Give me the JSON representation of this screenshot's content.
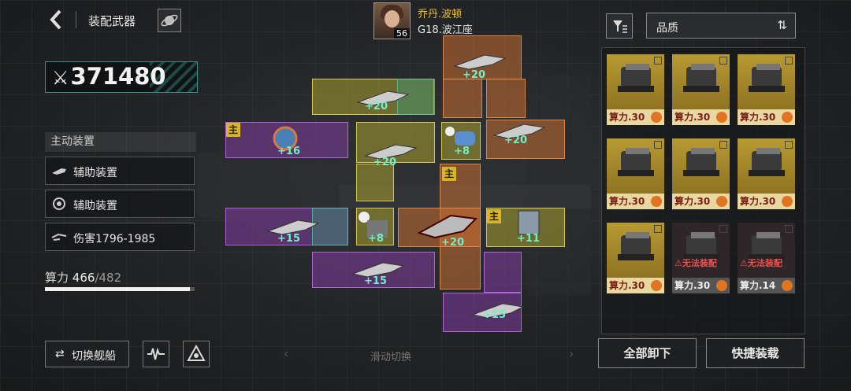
{
  "header": {
    "title": "装配武器",
    "pilot_name": "乔丹.波顿",
    "pilot_level": "56",
    "ship_name": "G18.波江座"
  },
  "left_panel": {
    "power": "371480",
    "active_header": "主动装置",
    "slots": [
      {
        "label": "辅助装置",
        "icon": "cannon-icon"
      },
      {
        "label": "辅助装置",
        "icon": "gear-icon"
      },
      {
        "label": "伤害1796-1985",
        "icon": "damage-icon"
      }
    ],
    "calc_label": "算力",
    "calc_used": "466",
    "calc_max": "/482",
    "calc_fraction": 0.967,
    "switch_label": "切换舰船"
  },
  "grid": {
    "main_tag": "主",
    "bonuses": [
      "+20",
      "+20",
      "+16",
      "+20",
      "+8",
      "+20",
      "+15",
      "+8",
      "+20",
      "+11",
      "+15",
      "+15"
    ],
    "slide_hint": "滑动切换"
  },
  "right_panel": {
    "sort_label": "品质",
    "cards": [
      {
        "label": "算力.30",
        "style": "gold",
        "icon": "gatling-icon"
      },
      {
        "label": "算力.30",
        "style": "gold",
        "icon": "turret-icon"
      },
      {
        "label": "算力.30",
        "style": "gold",
        "icon": "rocket-pod-icon"
      },
      {
        "label": "算力.30",
        "style": "gold",
        "icon": "missile-rack-icon"
      },
      {
        "label": "算力.30",
        "style": "gold",
        "icon": "railgun-icon"
      },
      {
        "label": "算力.30",
        "style": "gold",
        "icon": "plasma-icon"
      },
      {
        "label": "算力.30",
        "style": "gold",
        "icon": "drone-icon"
      },
      {
        "label": "算力.30",
        "style": "dark",
        "warning": "无法装配",
        "icon": "locked-weapon-icon"
      },
      {
        "label": "算力.14",
        "style": "dark",
        "warning": "无法装配",
        "icon": "locked-weapon-icon"
      }
    ],
    "unequip_all": "全部卸下",
    "quick_equip": "快捷装载"
  },
  "colors": {
    "accent_teal": "#3a8f84",
    "orange": "#c86e32",
    "yellow": "#aaa032",
    "purple": "#823ca0",
    "bonus_text": "#6ff0c9",
    "gold_card": "#b89a32"
  }
}
